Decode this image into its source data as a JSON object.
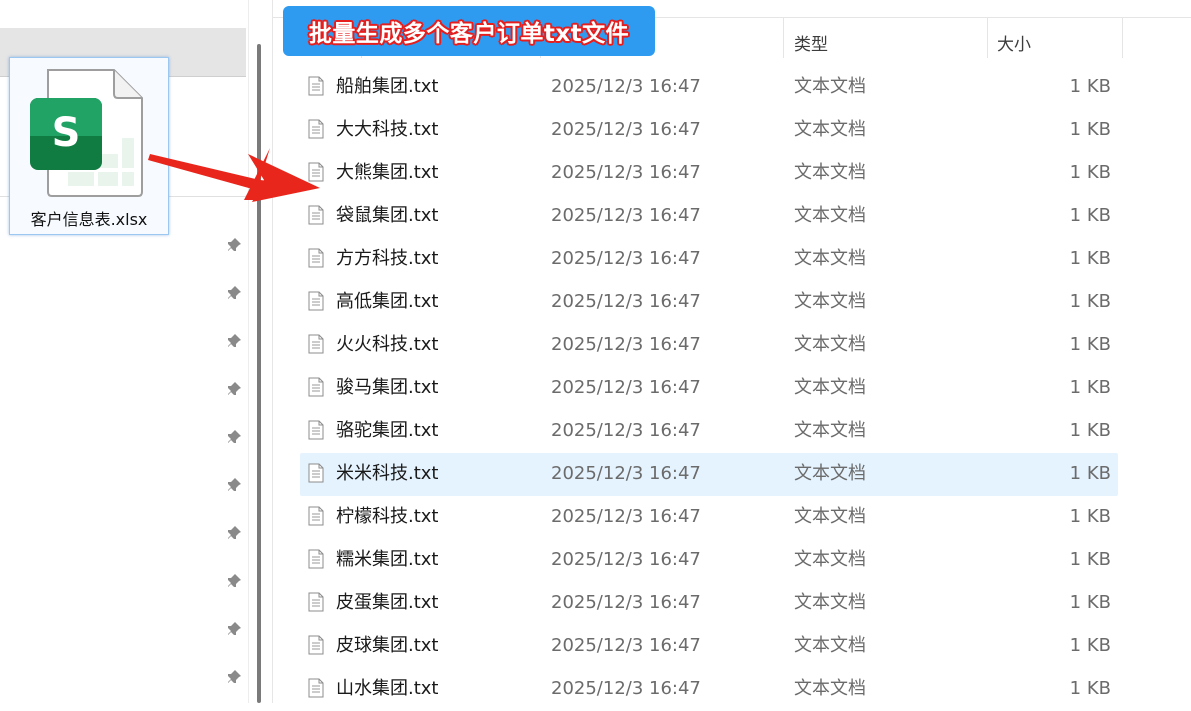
{
  "banner": {
    "title": "批量生成多个客户订单txt文件"
  },
  "source_file": {
    "name": "客户信息表.xlsx",
    "icon": "excel-spreadsheet-icon",
    "accent": "#0f9d58"
  },
  "columns": {
    "type": "类型",
    "size": "大小"
  },
  "files": [
    {
      "name": "船舶集团.txt",
      "date": "2025/12/3 16:47",
      "type": "文本文档",
      "size": "1 KB"
    },
    {
      "name": "大大科技.txt",
      "date": "2025/12/3 16:47",
      "type": "文本文档",
      "size": "1 KB"
    },
    {
      "name": "大熊集团.txt",
      "date": "2025/12/3 16:47",
      "type": "文本文档",
      "size": "1 KB"
    },
    {
      "name": "袋鼠集团.txt",
      "date": "2025/12/3 16:47",
      "type": "文本文档",
      "size": "1 KB"
    },
    {
      "name": "方方科技.txt",
      "date": "2025/12/3 16:47",
      "type": "文本文档",
      "size": "1 KB"
    },
    {
      "name": "高低集团.txt",
      "date": "2025/12/3 16:47",
      "type": "文本文档",
      "size": "1 KB"
    },
    {
      "name": "火火科技.txt",
      "date": "2025/12/3 16:47",
      "type": "文本文档",
      "size": "1 KB"
    },
    {
      "name": "骏马集团.txt",
      "date": "2025/12/3 16:47",
      "type": "文本文档",
      "size": "1 KB"
    },
    {
      "name": "骆驼集团.txt",
      "date": "2025/12/3 16:47",
      "type": "文本文档",
      "size": "1 KB"
    },
    {
      "name": "米米科技.txt",
      "date": "2025/12/3 16:47",
      "type": "文本文档",
      "size": "1 KB",
      "selected": true
    },
    {
      "name": "柠檬科技.txt",
      "date": "2025/12/3 16:47",
      "type": "文本文档",
      "size": "1 KB"
    },
    {
      "name": "糯米集团.txt",
      "date": "2025/12/3 16:47",
      "type": "文本文档",
      "size": "1 KB"
    },
    {
      "name": "皮蛋集团.txt",
      "date": "2025/12/3 16:47",
      "type": "文本文档",
      "size": "1 KB"
    },
    {
      "name": "皮球集团.txt",
      "date": "2025/12/3 16:47",
      "type": "文本文档",
      "size": "1 KB"
    },
    {
      "name": "山水集团.txt",
      "date": "2025/12/3 16:47",
      "type": "文本文档",
      "size": "1 KB"
    }
  ],
  "icons": {
    "file": "text-file-icon",
    "pin": "pin-icon",
    "arrow": "red-arrow-icon"
  },
  "colors": {
    "banner_bg": "#2f9bf0",
    "banner_outline": "#e61e1e",
    "selection": "#e5f3ff",
    "arrow": "#e8261c"
  }
}
